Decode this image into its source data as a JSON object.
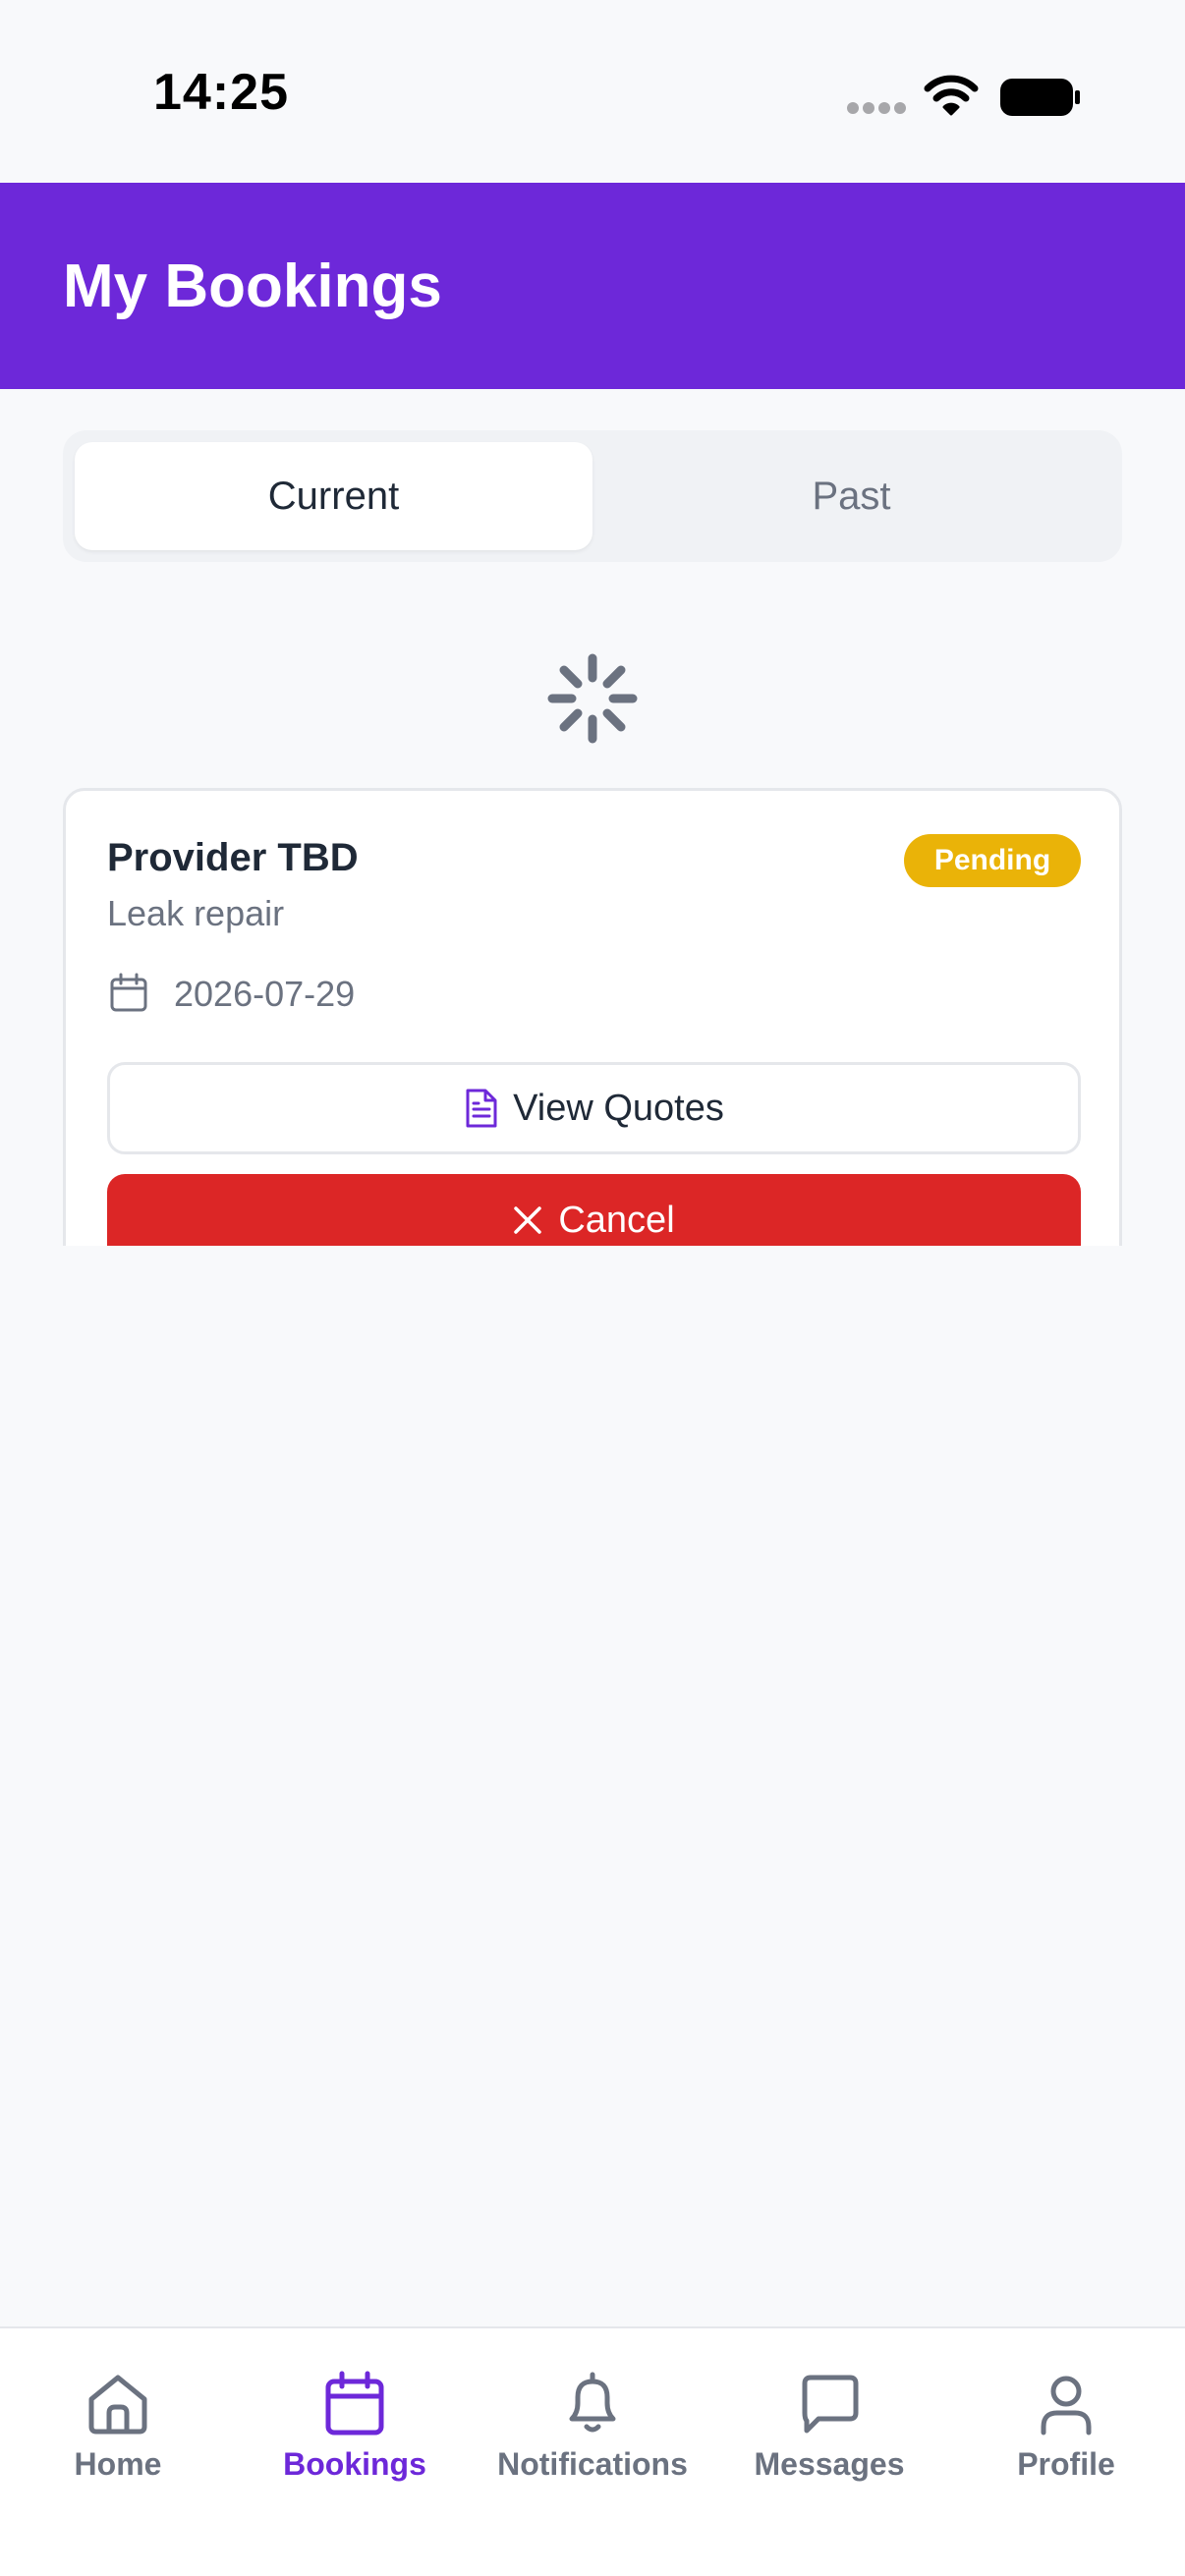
{
  "status_bar": {
    "time": "14:25"
  },
  "header": {
    "title": "My Bookings"
  },
  "tabs": [
    {
      "label": "Current",
      "selected": true
    },
    {
      "label": "Past",
      "selected": false
    }
  ],
  "booking": {
    "provider": "Provider TBD",
    "status": "Pending",
    "service": "Leak repair",
    "date": "2026-07-29",
    "view_quotes_label": "View Quotes",
    "cancel_label": "Cancel"
  },
  "bottom_nav": [
    {
      "label": "Home",
      "icon": "home-icon",
      "active": false
    },
    {
      "label": "Bookings",
      "icon": "calendar-icon",
      "active": true
    },
    {
      "label": "Notifications",
      "icon": "bell-icon",
      "active": false
    },
    {
      "label": "Messages",
      "icon": "message-icon",
      "active": false
    },
    {
      "label": "Profile",
      "icon": "user-icon",
      "active": false
    }
  ],
  "colors": {
    "primary": "#6d28d9",
    "pending": "#eab308",
    "danger": "#dc2626",
    "muted_text": "#6b7280",
    "background": "#f8f9fb"
  }
}
